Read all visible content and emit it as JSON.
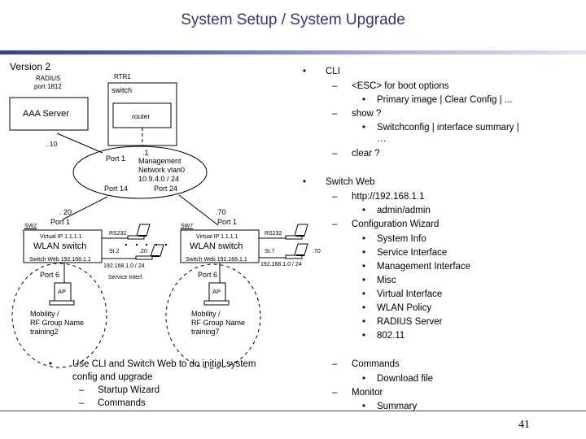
{
  "slide": {
    "title": "System Setup / System Upgrade",
    "page_number": "41",
    "accent_color": "#333380"
  },
  "diagram": {
    "version_label": "Version 2",
    "radius_label_1": "RADIUS",
    "radius_label_2": "port 1812",
    "aaa_server": "AAA Server",
    "aaa_ip": ". 10",
    "rtr1_label": "RTR1",
    "switch_label": "switch",
    "router_label": "router",
    "mgmt": {
      "ip": ".1",
      "line1": "Management",
      "line2": "Network vlan0",
      "line3": "10.9.4.0 / 24",
      "port_left": "Port 1",
      "port_bottom_left": "Port 14",
      "port_bottom_right": "Port 24"
    },
    "sw2": {
      "name": "SW2",
      "ip": ". 20",
      "port": "Port 1",
      "virtual_ip": "Virtual IP 1.1.1.1",
      "label": "WLAN switch",
      "switch_web": "Switch Web 192.168.1.1",
      "rs232": "RS232",
      "si": "SI.2",
      "laptop_ip": ".20",
      "service_net": "192.168.1.0 / 24",
      "service_label": "Service Interf.",
      "ap_port": "Port 6",
      "ap": "AP",
      "mobility_1": "Mobility /",
      "mobility_2": "RF Group Name",
      "mobility_3": "training2"
    },
    "sw7": {
      "name": "SW7",
      "ip": ".70",
      "port": "Port 1",
      "virtual_ip": "Virtual IP 1.1.1.1",
      "label": "WLAN switch",
      "switch_web": "Switch Web 192.168.1.1",
      "rs232": "RS232",
      "si": "SI.7",
      "laptop_ip": ".70",
      "service_net": "192.168.1.0 / 24",
      "ap_port": "Port 6",
      "ap": "AP",
      "mobility_1": "Mobility /",
      "mobility_2": "RF Group Name",
      "mobility_3": "training7"
    }
  },
  "left_bullets": {
    "main_line1": "Use CLI and Switch Web to do initial system",
    "main_line2": "config and upgrade",
    "sub": [
      "Startup Wizard",
      "Commands"
    ]
  },
  "right_bullets": {
    "cli": {
      "label": "CLI",
      "items": [
        {
          "label": "<ESC> for boot options",
          "sub": [
            "Primary image | Clear Config | ..."
          ]
        },
        {
          "label": "show ?",
          "sub": [
            "Switchconfig | interface summary |",
            "…"
          ]
        },
        {
          "label": "clear ?",
          "sub": []
        }
      ]
    },
    "web": {
      "label": "Switch Web",
      "items": [
        {
          "label": "http://192.168.1.1",
          "sub": [
            "admin/admin"
          ]
        },
        {
          "label": "Configuration Wizard",
          "sub": [
            "System Info",
            "Service Interface",
            "Management Interface",
            "Misc",
            "Virtual Interface",
            "WLAN Policy",
            "RADIUS Server",
            "802.11"
          ]
        },
        {
          "label": "Commands",
          "sub": [
            "Download file"
          ]
        },
        {
          "label": "Monitor",
          "sub": [
            "Summary"
          ]
        }
      ]
    },
    "bullet_glyph": "•",
    "dash_glyph": "–"
  }
}
